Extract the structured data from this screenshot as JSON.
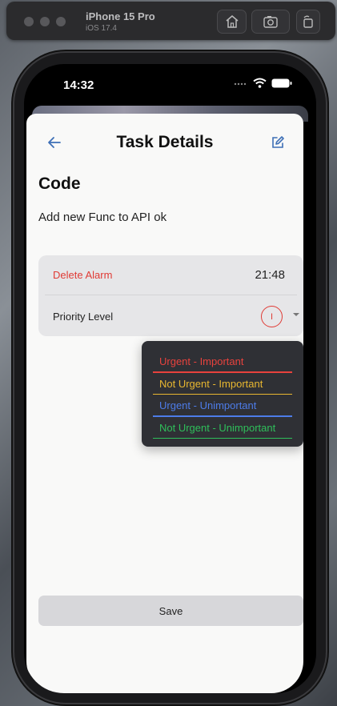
{
  "simulator": {
    "device_name": "iPhone 15 Pro",
    "os_version": "iOS 17.4"
  },
  "status_bar": {
    "time": "14:32"
  },
  "nav": {
    "title": "Task Details"
  },
  "task": {
    "title": "Code",
    "description": "Add new Func to API ok"
  },
  "alarm": {
    "delete_label": "Delete Alarm",
    "time": "21:48"
  },
  "priority": {
    "label": "Priority Level",
    "badge": "I",
    "badge_color": "#e03b35"
  },
  "priority_options": [
    {
      "label": "Urgent - Important",
      "color": "#e8423d"
    },
    {
      "label": "Not Urgent - Important",
      "color": "#e8b730"
    },
    {
      "label": "Urgent - Unimportant",
      "color": "#4d7ce8"
    },
    {
      "label": "Not Urgent - Unimportant",
      "color": "#2fbf5a"
    }
  ],
  "actions": {
    "save_label": "Save"
  },
  "colors": {
    "accent": "#3d6fb6",
    "danger": "#e03b35"
  }
}
